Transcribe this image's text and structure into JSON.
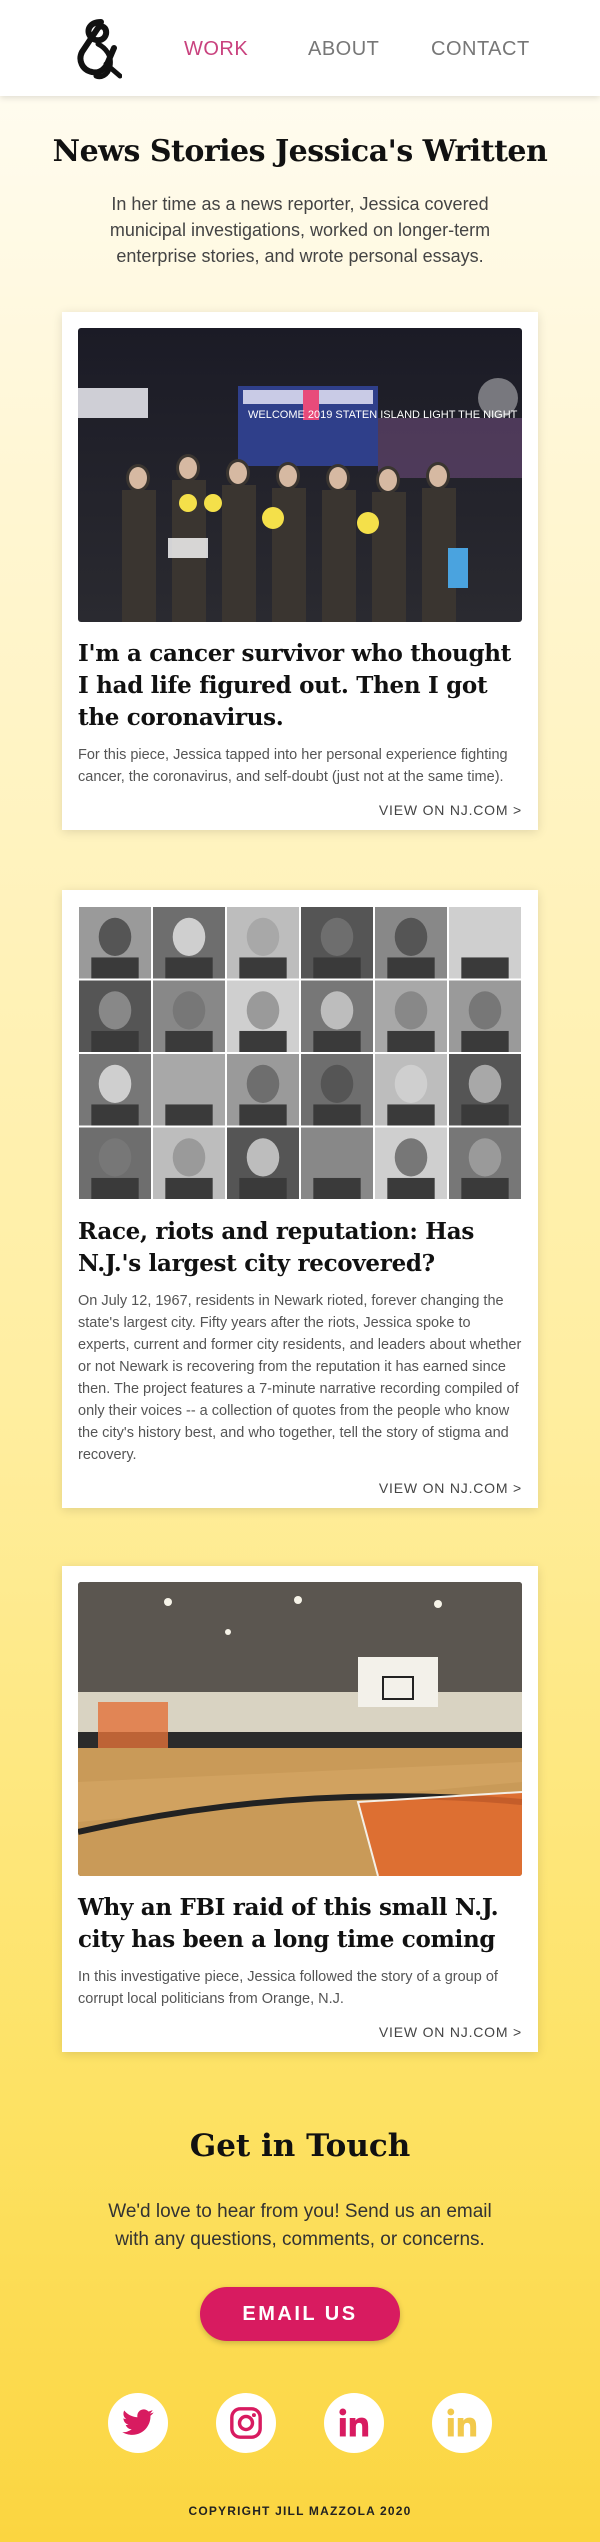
{
  "nav": {
    "logo_alt": "J&M monogram",
    "links": [
      {
        "label": "WORK",
        "active": true
      },
      {
        "label": "ABOUT",
        "active": false
      },
      {
        "label": "CONTACT",
        "active": false
      }
    ]
  },
  "header": {
    "title": "News Stories Jessica's Written",
    "intro": "In her time as a news reporter, Jessica covered municipal investigations, worked on longer-term enterprise stories, and wrote personal essays."
  },
  "cards": [
    {
      "title": "I'm a cancer survivor who thought I had life figured out. Then I got the coronavirus.",
      "description": "For this piece, Jessica tapped into her personal experience fighting cancer, the coronavirus, and self-doubt (just not at the same time).",
      "link": "VIEW ON NJ.COM >",
      "image_banner": "WELCOME 2019 STATEN ISLAND LIGHT THE NIGHT"
    },
    {
      "title": "Race, riots and reputation: Has N.J.'s largest city recovered?",
      "description": "On July 12, 1967, residents in Newark rioted, forever changing the state's largest city. Fifty years after the riots, Jessica spoke to experts, current and former city residents, and leaders about whether or not Newark is recovering from the reputation it has earned since then. The project features a 7-minute narrative recording compiled of only their voices -- a collection of quotes from the people who know the city's history best, and who together, tell the story of stigma and recovery.",
      "link": "VIEW ON NJ.COM >"
    },
    {
      "title": "Why an FBI raid of this small N.J. city has been a long time coming",
      "description": "In this investigative piece, Jessica followed the story of a group of corrupt local politicians from Orange, N.J.",
      "link": "VIEW ON NJ.COM >"
    }
  ],
  "contact": {
    "title": "Get in Touch",
    "text": "We'd love to hear from you! Send us an email with any questions, comments, or concerns.",
    "button": "EMAIL US"
  },
  "social": [
    {
      "icon": "twitter-icon"
    },
    {
      "icon": "instagram-icon"
    },
    {
      "icon": "linkedin-icon"
    },
    {
      "icon": "linkedin-icon"
    }
  ],
  "footer": {
    "copyright": "COPYRIGHT JILL MAZZOLA 2020"
  },
  "colors": {
    "accent": "#d81b60",
    "nav_active": "#c9427e",
    "gradient_top": "#fffdf6",
    "gradient_bottom": "#fbd540"
  }
}
